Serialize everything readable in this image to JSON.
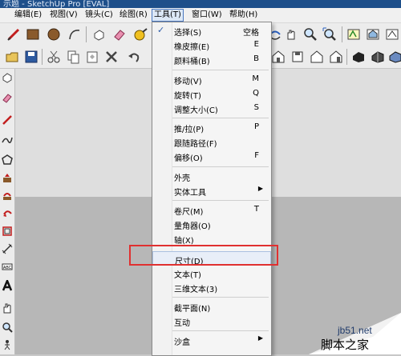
{
  "window": {
    "title": "示题 - SketchUp Pro [EVAL]"
  },
  "menubar": {
    "items": [
      {
        "label": "编辑(E)"
      },
      {
        "label": "视图(V)"
      },
      {
        "label": "镜头(C)"
      },
      {
        "label": "绘图(R)"
      },
      {
        "label": "工具(T)"
      },
      {
        "label": "窗口(W)"
      },
      {
        "label": "帮助(H)"
      }
    ]
  },
  "tools_menu": {
    "items": [
      {
        "label": "选择(S)",
        "shortcut": "空格",
        "checked": true
      },
      {
        "label": "橡皮擦(E)",
        "shortcut": "E"
      },
      {
        "label": "颜料桶(B)",
        "shortcut": "B"
      },
      {
        "label": "移动(V)",
        "shortcut": "M"
      },
      {
        "label": "旋转(T)",
        "shortcut": "Q"
      },
      {
        "label": "调整大小(C)",
        "shortcut": "S"
      },
      {
        "label": "推/拉(P)",
        "shortcut": "P"
      },
      {
        "label": "跟随路径(F)",
        "shortcut": ""
      },
      {
        "label": "偏移(O)",
        "shortcut": "F"
      },
      {
        "label": "外壳",
        "shortcut": ""
      },
      {
        "label": "实体工具",
        "shortcut": "",
        "submenu": true
      },
      {
        "label": "卷尺(M)",
        "shortcut": "T"
      },
      {
        "label": "量角器(O)",
        "shortcut": ""
      },
      {
        "label": "轴(X)",
        "shortcut": ""
      },
      {
        "label": "尺寸(D)",
        "shortcut": "",
        "highlighted": true
      },
      {
        "label": "文本(T)",
        "shortcut": ""
      },
      {
        "label": "三维文本(3)",
        "shortcut": ""
      },
      {
        "label": "截平面(N)",
        "shortcut": ""
      },
      {
        "label": "互动",
        "shortcut": ""
      },
      {
        "label": "沙盒",
        "shortcut": "",
        "submenu": true
      }
    ]
  },
  "watermark": {
    "url": "jb51.net",
    "site": "脚本之家"
  },
  "colors": {
    "highlight_border": "#e03030",
    "menu_accent": "#4a78c0"
  }
}
